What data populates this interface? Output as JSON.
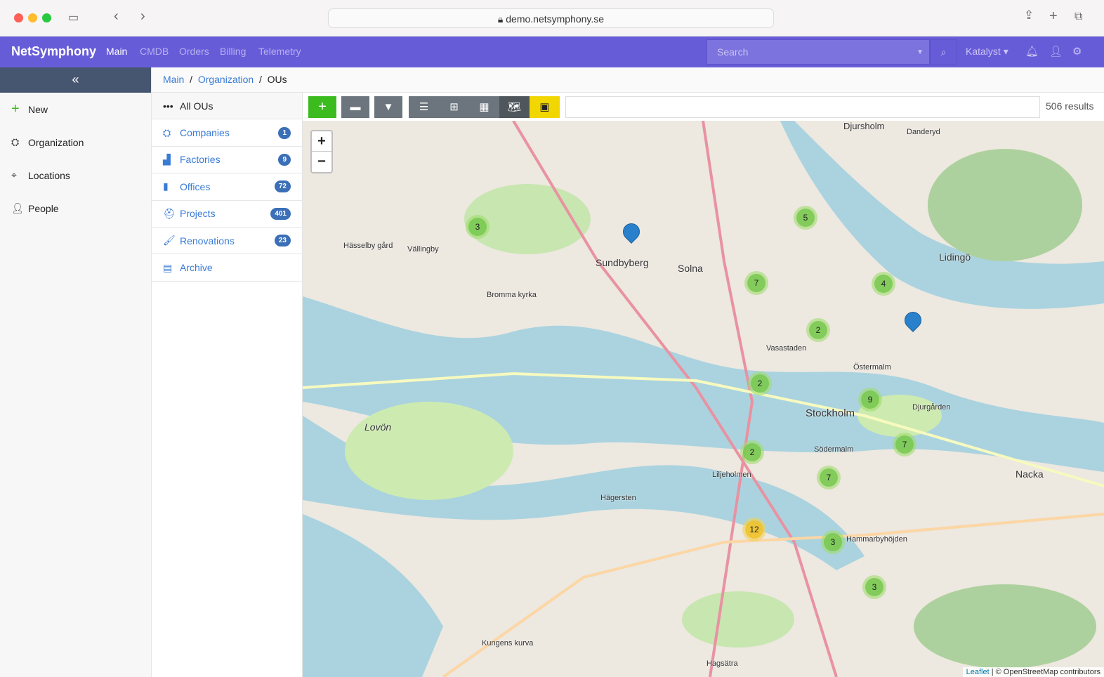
{
  "browser": {
    "url": "demo.netsymphony.se"
  },
  "navbar": {
    "brand": "NetSymphony",
    "links": [
      "Main",
      "CMDB",
      "Orders",
      "Billing",
      "Telemetry"
    ],
    "search_placeholder": "Search",
    "user": "Katalyst"
  },
  "sidebar": {
    "collapse": "«",
    "items": [
      {
        "label": "New"
      },
      {
        "label": "Organization"
      },
      {
        "label": "Locations"
      },
      {
        "label": "People"
      }
    ]
  },
  "breadcrumb": [
    "Main",
    "Organization",
    "OUs"
  ],
  "ou_list": [
    {
      "label": "All OUs"
    },
    {
      "label": "Companies",
      "count": "1"
    },
    {
      "label": "Factories",
      "count": "9"
    },
    {
      "label": "Offices",
      "count": "72"
    },
    {
      "label": "Projects",
      "count": "401"
    },
    {
      "label": "Renovations",
      "count": "23"
    },
    {
      "label": "Archive"
    }
  ],
  "toolbar": {
    "results": "506 results"
  },
  "map": {
    "zoom_in": "+",
    "zoom_out": "−",
    "clusters": [
      "3",
      "5",
      "7",
      "4",
      "2",
      "2",
      "9",
      "7",
      "2",
      "7",
      "12",
      "3",
      "3"
    ],
    "labels": [
      "Djursholm",
      "Sundbyberg",
      "Solna",
      "Stockholm",
      "Lidingö",
      "Nacka",
      "Lovön",
      "Bromma kyrka",
      "Vasastaden",
      "Södermalm",
      "Hammarbyhöjden",
      "Liljeholmen",
      "Hägersten",
      "Danderyd",
      "Vällingby",
      "Hässelby gård",
      "Djurgården",
      "Östermalm",
      "Kungens kurva",
      "Hagsätra"
    ],
    "attribution_leaflet": "Leaflet",
    "attribution": "| © OpenStreetMap contributors"
  }
}
